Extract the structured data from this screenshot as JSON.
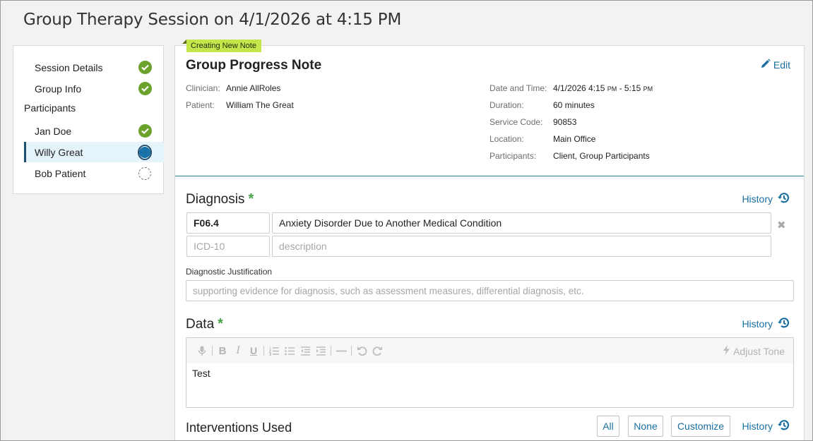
{
  "page": {
    "title": "Group Therapy Session on 4/1/2026 at 4:15 PM"
  },
  "sidebar": {
    "items": [
      {
        "label": "Session Details",
        "status": "complete"
      },
      {
        "label": "Group Info",
        "status": "complete"
      }
    ],
    "section_label": "Participants",
    "participants": [
      {
        "label": "Jan Doe",
        "status": "complete"
      },
      {
        "label": "Willy Great",
        "status": "current"
      },
      {
        "label": "Bob Patient",
        "status": "pending"
      }
    ]
  },
  "note": {
    "badge": "Creating New Note",
    "title": "Group Progress Note",
    "edit_label": "Edit",
    "left_info": [
      {
        "key": "Clinician:",
        "value": "Annie AllRoles"
      },
      {
        "key": "Patient:",
        "value": "William The Great"
      }
    ],
    "right_info": {
      "date_key": "Date and Time:",
      "date_start": "4/1/2026 4:15 ",
      "date_start_ampm": "PM",
      "date_sep": " - 5:15 ",
      "date_end_ampm": "PM",
      "rows": [
        {
          "key": "Duration:",
          "value": "60 minutes"
        },
        {
          "key": "Service Code:",
          "value": "90853"
        },
        {
          "key": "Location:",
          "value": "Main Office"
        },
        {
          "key": "Participants:",
          "value": "Client, Group Participants"
        }
      ]
    }
  },
  "diagnosis": {
    "title": "Diagnosis",
    "required_mark": "*",
    "history_label": "History",
    "rows": [
      {
        "code": "F06.4",
        "description": "Anxiety Disorder Due to Another Medical Condition"
      }
    ],
    "code_placeholder": "ICD-10",
    "description_placeholder": "description",
    "remove_glyph": "✖",
    "justification_label": "Diagnostic Justification",
    "justification_placeholder": "supporting evidence for diagnosis, such as assessment measures, differential diagnosis, etc."
  },
  "data_section": {
    "title": "Data",
    "required_mark": "*",
    "history_label": "History",
    "adjust_tone_label": "Adjust Tone",
    "content": "Test",
    "toolbar_icons": [
      "microphone-icon",
      "bold-icon",
      "italic-icon",
      "underline-icon",
      "numbered-list-icon",
      "bullet-list-icon",
      "outdent-icon",
      "indent-icon",
      "horizontal-rule-icon",
      "undo-icon",
      "redo-icon"
    ]
  },
  "interventions": {
    "title": "Interventions Used",
    "all_label": "All",
    "none_label": "None",
    "customize_label": "Customize",
    "history_label": "History"
  },
  "colors": {
    "accent": "#1a6fa0",
    "complete_green": "#6aa22c",
    "badge_bg": "#c4e64a",
    "divider": "#2d7ea3",
    "active_bg": "#e5f3fb"
  }
}
